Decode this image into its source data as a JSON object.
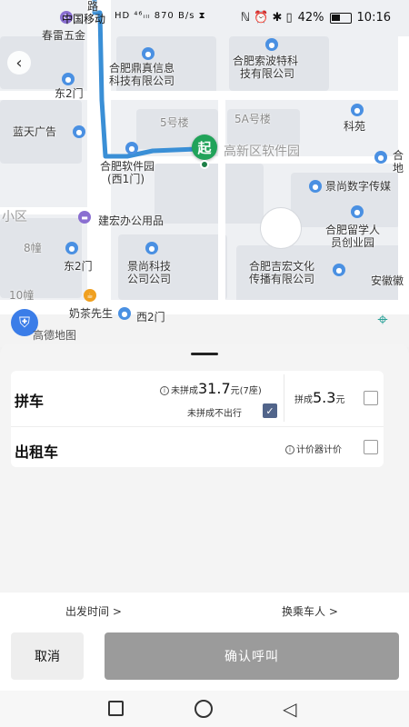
{
  "status_bar": {
    "carrier": "中国移动",
    "icons_left": "HD ⁴⁶ᵢₗₗ 870 B/s ⧗",
    "battery_pct": "42%",
    "time": "10:16"
  },
  "map": {
    "pois": [
      {
        "text": "路"
      },
      {
        "text": "春雷五金"
      },
      {
        "text": "合肥鼎真信息"
      },
      {
        "text": "科技有限公司"
      },
      {
        "text": "合肥索波特科"
      },
      {
        "text": "技有限公司"
      },
      {
        "text": "东2门"
      },
      {
        "text": "5号楼"
      },
      {
        "text": "5A号楼"
      },
      {
        "text": "科苑"
      },
      {
        "text": "蓝天广告"
      },
      {
        "text": "合肥软件园"
      },
      {
        "text": "(西1门)"
      },
      {
        "text": "高新区软件园"
      },
      {
        "text": "合"
      },
      {
        "text": "地"
      },
      {
        "text": "景尚数字传媒"
      },
      {
        "text": "小区"
      },
      {
        "text": "建宏办公用品"
      },
      {
        "text": "合肥留学人"
      },
      {
        "text": "员创业园"
      },
      {
        "text": "8幢"
      },
      {
        "text": "东2门"
      },
      {
        "text": "景尚科技"
      },
      {
        "text": "公司公司"
      },
      {
        "text": "合肥吉宏文化"
      },
      {
        "text": "传播有限公司"
      },
      {
        "text": "安徽徽"
      },
      {
        "text": "10幢"
      },
      {
        "text": "奶茶先生"
      },
      {
        "text": "西2门"
      }
    ],
    "start_marker": "起",
    "logo_text": "高德地图",
    "back_icon": "chevron-left-icon",
    "colors": {
      "route": "#3a8fd6",
      "start": "#21a35a"
    }
  },
  "sheet": {
    "carpool": {
      "title": "拼车",
      "nopool_label": "未拼成",
      "nopool_price": "31.7",
      "nopool_unit": "元(7座)",
      "nogo_label": "未拼成不出行",
      "nogo_checked": true,
      "pool_label": "拼成",
      "pool_price": "5.3",
      "pool_unit": "元",
      "pool_checked": false
    },
    "taxi": {
      "title": "出租车",
      "meter_label": "计价器计价",
      "meter_checked": false
    }
  },
  "bottom": {
    "depart_time": "出发时间 >",
    "change_rider": "换乘车人 >",
    "cancel": "取消",
    "confirm": "确认呼叫"
  }
}
